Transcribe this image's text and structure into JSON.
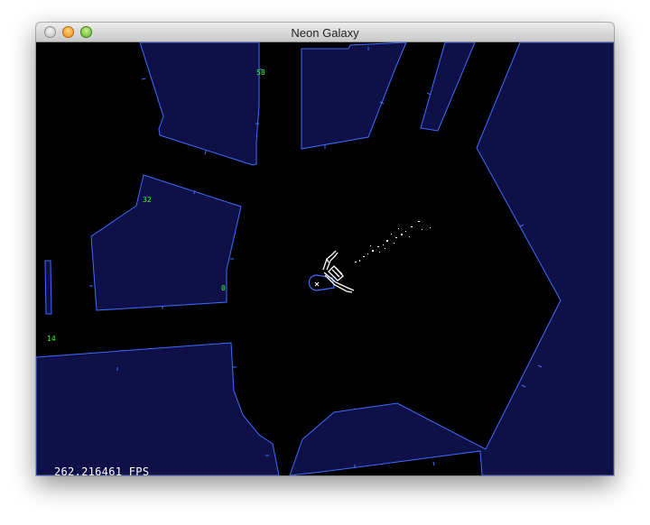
{
  "window": {
    "title": "Neon Galaxy"
  },
  "hud": {
    "fps_text": "262.216461 FPS"
  },
  "markers": {
    "m1": "58",
    "m2": "32",
    "m3": "0",
    "m4": "14"
  },
  "colors": {
    "wall_fill": "#0f1048",
    "wall_stroke": "#3f6dff",
    "space": "#000000",
    "marker": "#33ff33",
    "ship": "#ffffff",
    "hud_text": "#ffffff"
  }
}
